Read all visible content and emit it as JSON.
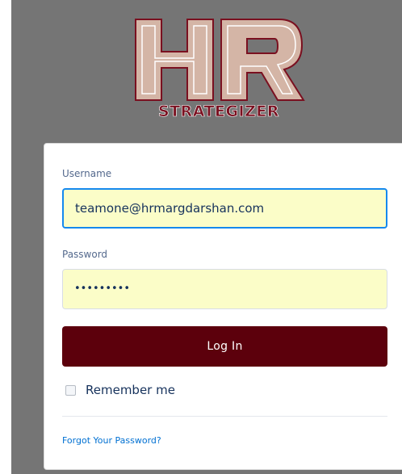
{
  "logo": {
    "letters": "HR",
    "tagline": "STRATEGIZER"
  },
  "login_form": {
    "username_label": "Username",
    "username_value": "teamone@hrmargdarshan.com",
    "password_label": "Password",
    "password_value": "•••••••••",
    "login_button": "Log In",
    "remember_label": "Remember me",
    "remember_checked": false,
    "forgot_link": "Forgot Your Password?"
  },
  "colors": {
    "background": "#757575",
    "button": "#5c000c",
    "field_fill": "#fbfdc8",
    "link": "#0070d2",
    "focus_border": "#1589ee"
  }
}
